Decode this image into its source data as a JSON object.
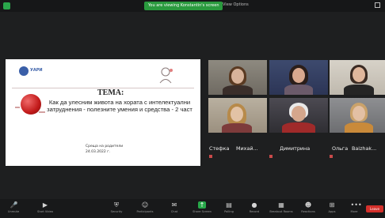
{
  "topbar": {
    "recording_banner": "You are viewing Konstantin's screen",
    "view_options": "View Options"
  },
  "slide": {
    "logo_text": "УАРИ",
    "heading": "ТЕМА:",
    "subtitle": "Как да улесним живота на хората с интелектуални затруднения - полезните умения и средства - 2 част",
    "footer_org": "Среща на родители",
    "footer_date": "24.03.2022 г."
  },
  "participants": {
    "lower_names": [
      "Стефка",
      "Михай...",
      "Димитрина",
      "Ольга",
      "Baizhak..."
    ]
  },
  "toolbar": {
    "items": [
      {
        "label": "Unmute",
        "icon": "microphone-icon"
      },
      {
        "label": "Start Video",
        "icon": "video-camera-icon"
      },
      {
        "label": "Security",
        "icon": "shield-icon"
      },
      {
        "label": "Participants",
        "icon": "people-icon"
      },
      {
        "label": "Chat",
        "icon": "chat-bubble-icon"
      },
      {
        "label": "Share Screen",
        "icon": "share-screen-icon"
      },
      {
        "label": "Polling",
        "icon": "poll-icon"
      },
      {
        "label": "Record",
        "icon": "record-icon"
      },
      {
        "label": "Breakout Rooms",
        "icon": "breakout-rooms-icon"
      },
      {
        "label": "Reactions",
        "icon": "smiley-icon"
      },
      {
        "label": "Apps",
        "icon": "apps-icon"
      },
      {
        "label": "More",
        "icon": "more-icon"
      }
    ],
    "leave_label": "Leave"
  },
  "colors": {
    "background": "#1e1f20",
    "toolbar": "#18191a",
    "recording_green": "#2a9a3e",
    "active_speaker": "#d6d13a",
    "leave_red": "#d3302b"
  }
}
